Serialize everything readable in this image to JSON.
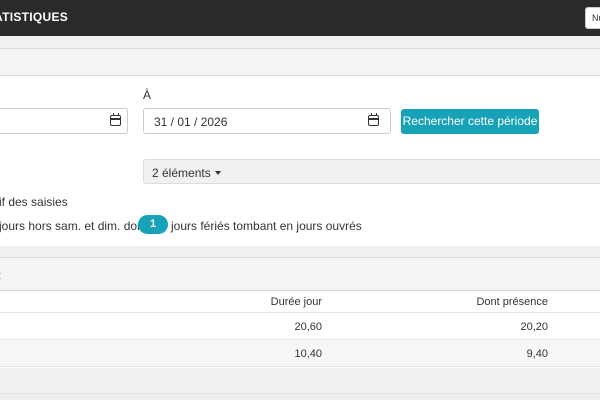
{
  "navbar": {
    "title": "ATISTIQUES",
    "button_text": "Nu"
  },
  "filters": {
    "to_label": "À",
    "from_date": {
      "value": ""
    },
    "to_date": {
      "value": "31 / 01 / 2026"
    },
    "search_button": "Rechercher cette période",
    "select": {
      "value": "2 éléments"
    },
    "summary_label": "if des saisies",
    "days_text_prefix": "jours hors sam. et dim. dont",
    "holidays_count": "1",
    "days_text_suffix": "jours fériés tombant en jours ouvrés"
  },
  "section": {
    "title": ":"
  },
  "table": {
    "columns": [
      "Durée jour",
      "Dont présence"
    ],
    "rows": [
      [
        "20,60",
        "20,20"
      ],
      [
        "10,40",
        "9,40"
      ]
    ]
  },
  "colors": {
    "navbar": "#2b2b2b",
    "accent": "#17a2b8"
  }
}
